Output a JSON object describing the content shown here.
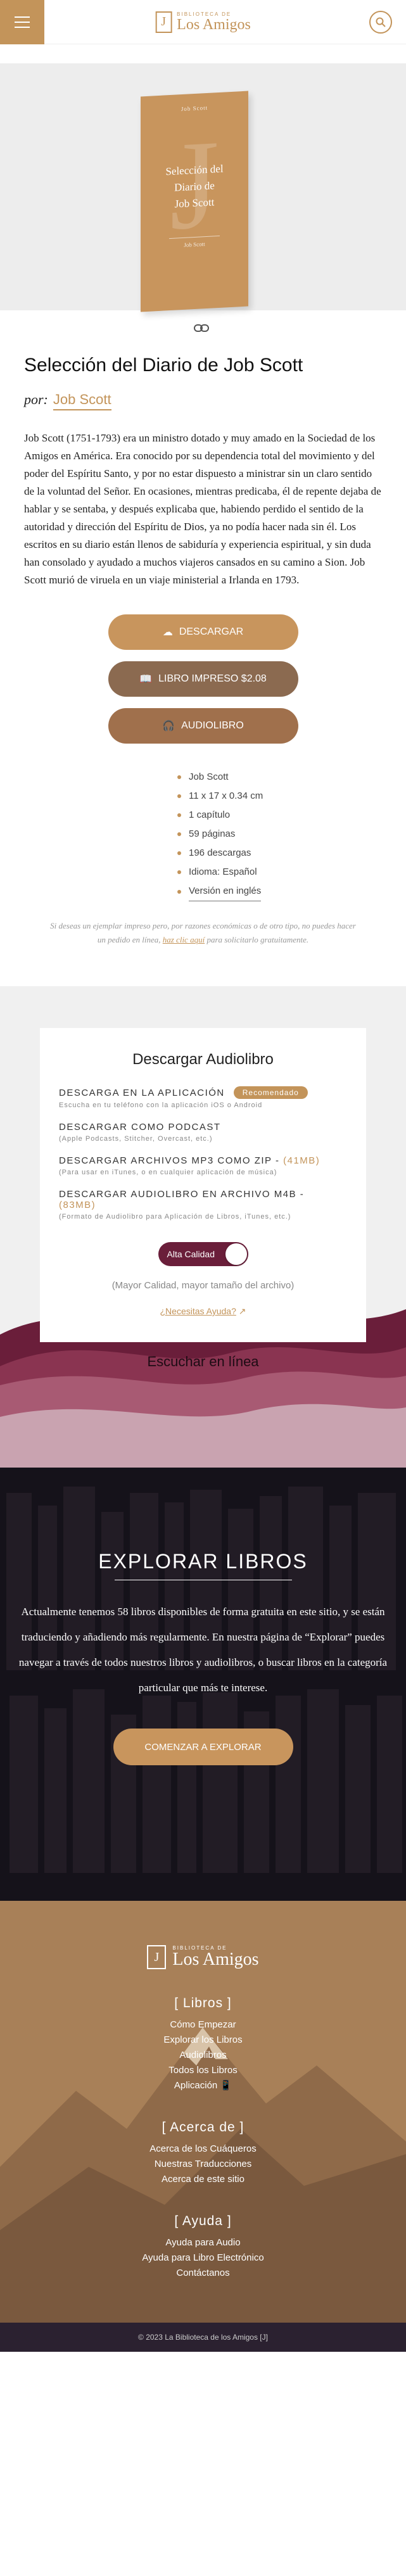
{
  "header": {
    "logo_small": "Biblioteca de",
    "logo_big": "Los Amigos",
    "logo_mark": "[J]",
    "menu_icon": "hamburger-icon",
    "search_icon": "search-icon"
  },
  "cover": {
    "author": "Job Scott",
    "letter": "J",
    "title_line1": "Selección del",
    "title_line2": "Diario de",
    "title_line3": "Job Scott",
    "publisher": "Job Scott"
  },
  "book": {
    "title": "Selección del Diario de Job Scott",
    "author_label": "por:",
    "author_name": "Job Scott",
    "description": "Job Scott (1751-1793) era un ministro dotado y muy amado en la Sociedad de los Amigos en América. Era conocido por su dependencia total del movimiento y del poder del Espíritu Santo, y por no estar dispuesto a ministrar sin un claro sentido de la voluntad del Señor. En ocasiones, mientras predicaba, él de repente dejaba de hablar y se sentaba, y después explicaba que, habiendo perdido el sentido de la autoridad y dirección del Espíritu de Dios, ya no podía hacer nada sin él. Los escritos en su diario están llenos de sabiduría y experiencia espiritual, y sin duda han consolado y ayudado a muchos viajeros cansados en su camino a Sion. Job Scott murió de viruela en un viaje ministerial a Irlanda en 1793."
  },
  "buttons": {
    "download": "Descargar",
    "print": "Libro Impreso $2.08",
    "audio": "Audiolibro"
  },
  "details": [
    "Job Scott",
    "11 x 17 x 0.34 cm",
    "1 capítulo",
    "59 páginas",
    "196 descargas",
    "Idioma: Español",
    "Versión en inglés"
  ],
  "note": {
    "before": "Si deseas un ejemplar impreso pero, por razones económicas o de otro tipo, no puedes hacer un pedido en línea,",
    "link": "haz clic aquí",
    "after": "para solicitarlo gratuitamente."
  },
  "audio": {
    "heading": "Descargar Audiolibro",
    "options": [
      {
        "title": "Descarga en la aplicación",
        "badge": "Recomendado",
        "size": "",
        "sub": "Escucha en tu teléfono con la aplicación iOS o Android"
      },
      {
        "title": "Descargar como podcast",
        "badge": "",
        "size": "",
        "sub": "(Apple Podcasts, Stitcher, Overcast, etc.)"
      },
      {
        "title": "Descargar archivos MP3 como ZIP -",
        "badge": "",
        "size": "(41MB)",
        "sub": "(Para usar en iTunes, o en cualquier aplicación de música)"
      },
      {
        "title": "Descargar audiolibro en archivo M4B -",
        "badge": "",
        "size": "(83MB)",
        "sub": "(Formato de Audiolibro para Aplicación de Libros, iTunes, etc.)"
      }
    ],
    "toggle_label": "Alta Calidad",
    "quality_note": "(Mayor Calidad, mayor tamaño del archivo)",
    "help": "¿Necesitas Ayuda?",
    "listen": "Escuchar en línea"
  },
  "explore": {
    "heading": "Explorar Libros",
    "text": "Actualmente tenemos 58 libros disponibles de forma gratuita en este sitio, y se están traduciendo y añadiendo más regularmente. En nuestra página de “Explorar” puedes navegar a través de todos nuestros libros y audiolibros, o buscar libros en la categoría particular que más te interese.",
    "button": "Comenzar a explorar"
  },
  "footer": {
    "logo_small": "Biblioteca de",
    "logo_big": "Los Amigos",
    "sections": [
      {
        "heading": "[ Libros ]",
        "items": [
          "Cómo Empezar",
          "Explorar los Libros",
          "Audiolibros",
          "Todos los Libros",
          "Aplicación 📱"
        ]
      },
      {
        "heading": "[ Acerca de ]",
        "items": [
          "Acerca de los Cuáqueros",
          "Nuestras Traducciones",
          "Acerca de este sitio"
        ]
      },
      {
        "heading": "[ Ayuda ]",
        "items": [
          "Ayuda para Audio",
          "Ayuda para Libro Electrónico",
          "Contáctanos"
        ]
      }
    ],
    "copyright": "© 2023 La Biblioteca de los Amigos [J]"
  }
}
